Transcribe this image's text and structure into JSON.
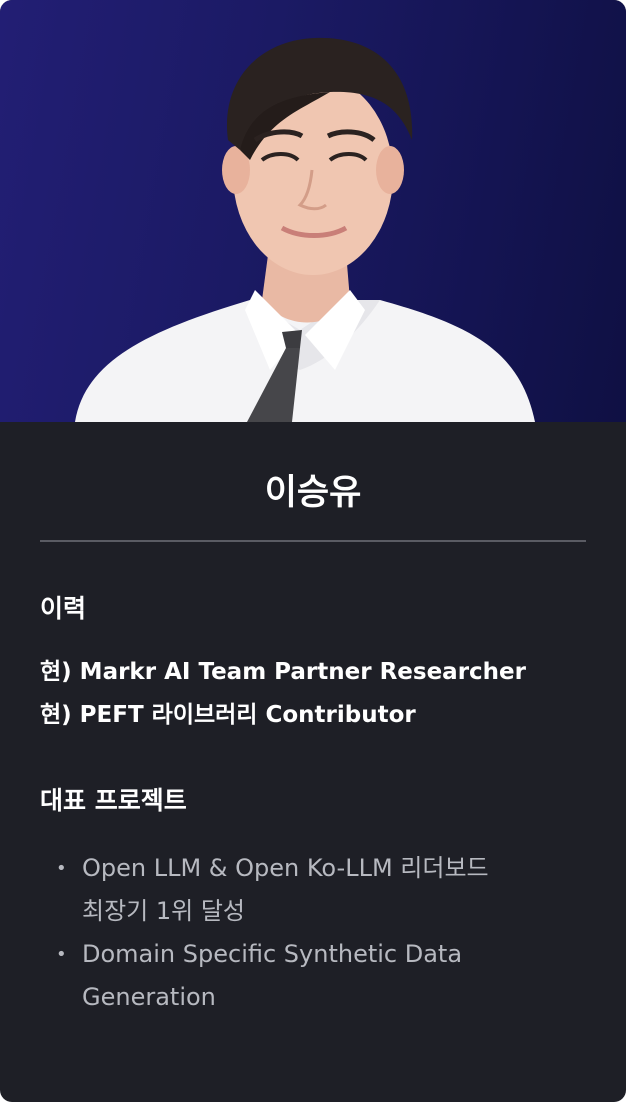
{
  "profile": {
    "name": "이승유"
  },
  "career": {
    "title": "이력",
    "items": [
      "현) Markr AI Team Partner Researcher",
      "현) PEFT 라이브러리 Contributor"
    ]
  },
  "projects": {
    "title": "대표 프로젝트",
    "items": [
      {
        "lines": [
          "Open LLM & Open Ko-LLM 리더보드",
          "최장기 1위 달성"
        ]
      },
      {
        "lines": [
          "Domain Specific Synthetic Data",
          "Generation"
        ]
      }
    ]
  },
  "colors": {
    "card_background": "#1e1f26",
    "photo_background": "#1b1a64",
    "text_primary": "#ffffff",
    "text_secondary": "#b7b9c0",
    "divider": "#5a5b63"
  }
}
